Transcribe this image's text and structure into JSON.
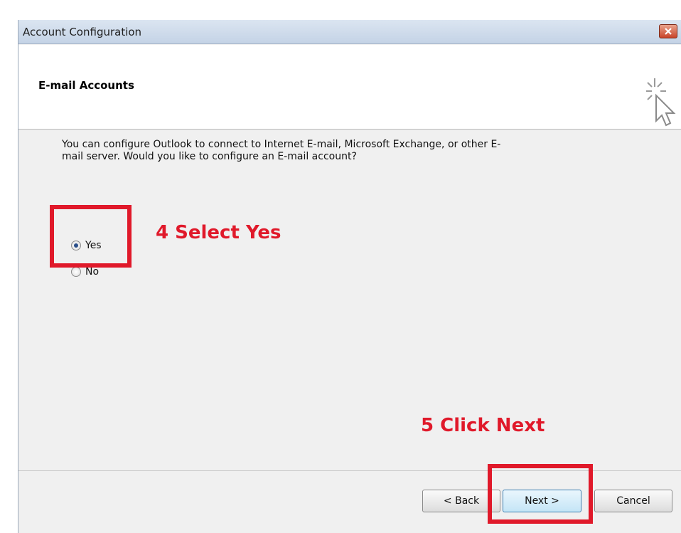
{
  "window": {
    "title": "Account Configuration"
  },
  "header": {
    "title": "E-mail Accounts"
  },
  "intro_text": "You can configure Outlook to connect to Internet E-mail, Microsoft Exchange, or other E-mail server. Would you like to configure an E-mail account?",
  "options": {
    "yes_label": "Yes",
    "no_label": "No",
    "selected": "Yes"
  },
  "annotations": {
    "step4": "4 Select Yes",
    "step5": "5 Click Next",
    "color": "#e0192a"
  },
  "buttons": {
    "back": "< Back",
    "next": "Next >",
    "cancel": "Cancel"
  }
}
